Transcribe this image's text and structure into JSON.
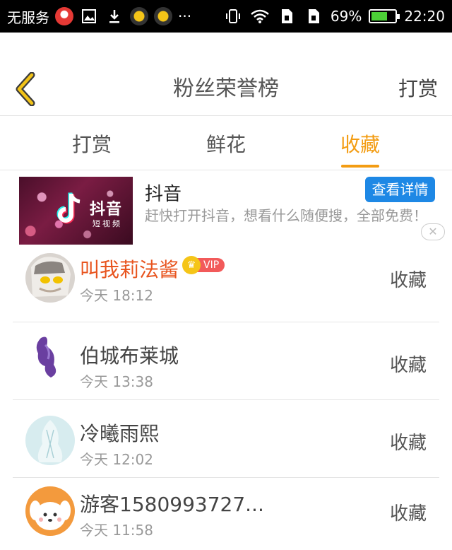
{
  "status_bar": {
    "carrier": "无服务",
    "battery_percent": "69%",
    "battery_level": 0.69,
    "time": "22:20",
    "more": "···"
  },
  "header": {
    "title": "粉丝荣誉榜",
    "right_action": "打赏"
  },
  "tabs": [
    {
      "label": "打赏",
      "active": false
    },
    {
      "label": "鲜花",
      "active": false
    },
    {
      "label": "收藏",
      "active": true
    }
  ],
  "ad": {
    "title": "抖音",
    "image_text": "抖音",
    "image_subtext": "短视频",
    "button_label": "查看详情",
    "description": "赶快打开抖音，想看什么随便搜，全部免费！",
    "close_symbol": "✕"
  },
  "fans": [
    {
      "name": "叫我莉法酱",
      "time": "今天 18:12",
      "action": "收藏",
      "vip": true,
      "vip_label": "VIP"
    },
    {
      "name": "伯城布莱城",
      "time": "今天 13:38",
      "action": "收藏",
      "vip": false
    },
    {
      "name": "冷曦雨熙",
      "time": "今天 12:02",
      "action": "收藏",
      "vip": false
    },
    {
      "name": "游客1580993727...",
      "time": "今天 11:58",
      "action": "收藏",
      "vip": false
    }
  ],
  "colors": {
    "accent": "#f39c12",
    "vip_name": "#e8541e",
    "button_blue": "#1e88e5"
  }
}
